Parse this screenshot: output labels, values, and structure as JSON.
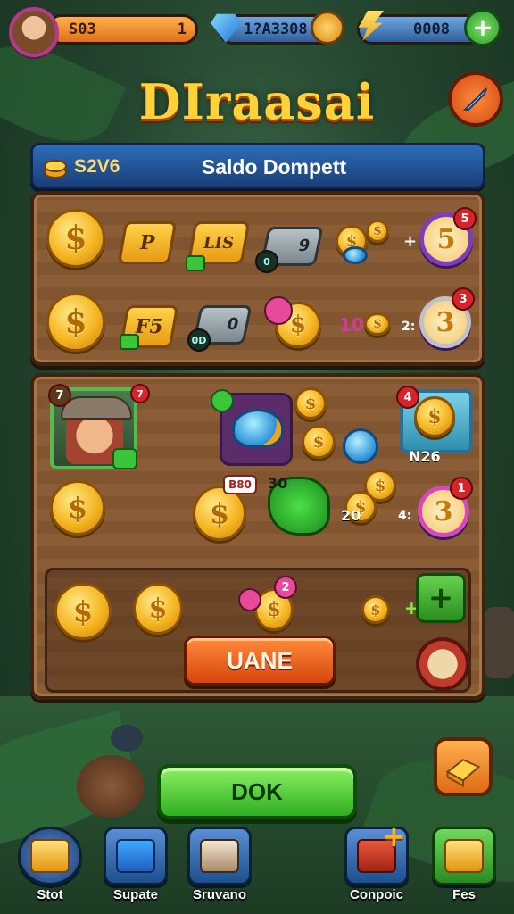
{
  "topbar": {
    "coins_value": "S03",
    "coins_extra": "1",
    "gems_value": "1?A3308",
    "energy_value": "0008"
  },
  "title": "DIraasai",
  "header": {
    "code": "S2V6",
    "label": "Saldo Dompett"
  },
  "panel1": {
    "row1": {
      "tag1": "P",
      "tag2": "LIS",
      "card_num": "9",
      "card_chip": "0",
      "badge_num": "5",
      "badge_dot": "5"
    },
    "row2": {
      "tag1": "F5",
      "card_num": "0",
      "chip": "0D",
      "mid_text": "10",
      "badge_num": "3",
      "badge_dot": "3",
      "sep": "2:"
    }
  },
  "panel2": {
    "hero_badge": "7",
    "hero_corner": "7",
    "crate_label": "N26",
    "crate_badge": "4",
    "price_tag": "B80",
    "blob_text": "30",
    "mid_value": "20",
    "ring_num": "3",
    "ring_dot": "1",
    "small_badge_z": "2",
    "action_button": "UANE"
  },
  "ok_button": "DOK",
  "nav": [
    {
      "label": "Stot"
    },
    {
      "label": "Supate"
    },
    {
      "label": "Sruvano"
    },
    {
      "label": "Conpoic"
    },
    {
      "label": "Fes"
    }
  ],
  "colors": {
    "accent_orange": "#e0701a",
    "accent_blue": "#2c6cb8",
    "accent_green": "#2fae22",
    "title_gold": "#ffd23a"
  }
}
